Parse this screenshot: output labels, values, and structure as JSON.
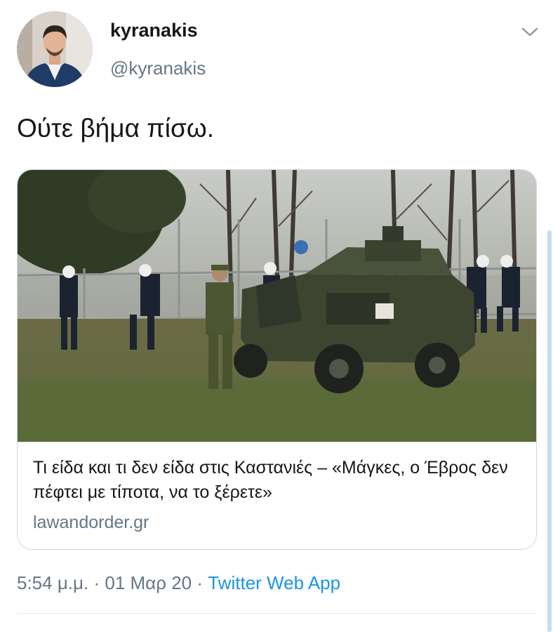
{
  "tweet": {
    "display_name": "kyranakis",
    "handle": "@kyranakis",
    "text": "Ούτε βήμα πίσω.",
    "menu_icon": "chevron-down-icon"
  },
  "card": {
    "title": "Τι είδα και τι δεν είδα στις Καστανιές – «Μάγκες, ο Έβρος δεν πέφτει με τίποτα, να το ξέρετε»",
    "domain": "lawandorder.gr"
  },
  "meta": {
    "time": "5:54 μ.μ.",
    "sep1": " · ",
    "date": "01 Μαρ 20",
    "sep2": " · ",
    "source": "Twitter Web App"
  },
  "colors": {
    "text": "#14171a",
    "secondary": "#657786",
    "link": "#1b95e0",
    "border": "#cfd9de"
  }
}
